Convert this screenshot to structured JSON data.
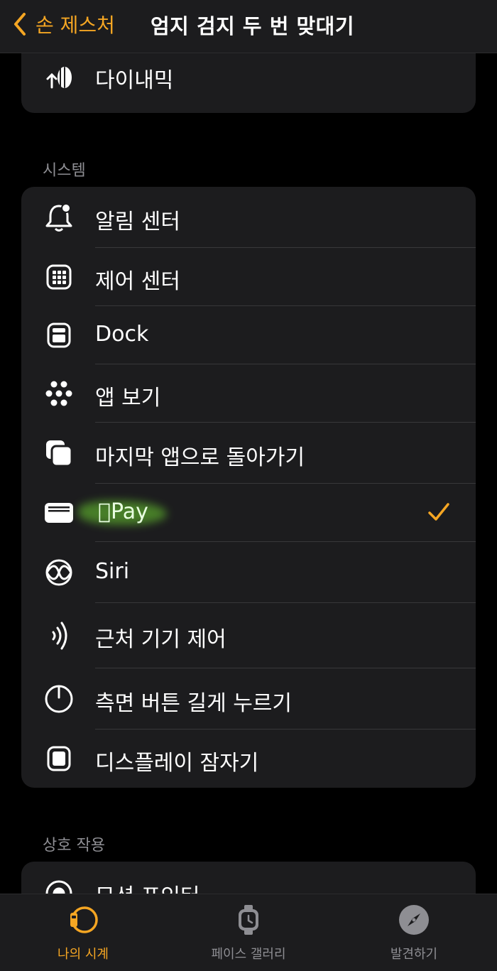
{
  "header": {
    "back_label": "손 제스처",
    "title": "엄지 검지 두 번 맞대기"
  },
  "top_item": {
    "label": "다이내믹",
    "icon": "dynamic-icon"
  },
  "system_section": {
    "header": "시스템",
    "items": [
      {
        "label": "알림 센터",
        "icon": "bell-icon"
      },
      {
        "label": "제어 센터",
        "icon": "control-center-icon"
      },
      {
        "label": "Dock",
        "icon": "dock-icon"
      },
      {
        "label": "앱 보기",
        "icon": "app-grid-icon"
      },
      {
        "label": "마지막 앱으로 돌아가기",
        "icon": "last-app-icon"
      },
      {
        "label": "Pay",
        "icon": "wallet-icon",
        "selected": true
      },
      {
        "label": "Siri",
        "icon": "siri-icon"
      },
      {
        "label": "근처 기기 제어",
        "icon": "nearby-icon"
      },
      {
        "label": "측면 버튼 길게 누르기",
        "icon": "power-icon"
      },
      {
        "label": "디스플레이 잠자기",
        "icon": "display-icon"
      }
    ]
  },
  "interaction_section": {
    "header": "상호 작용",
    "items": [
      {
        "label": "모션 포인터",
        "icon": "motion-pointer-icon"
      }
    ]
  },
  "tabbar": {
    "items": [
      {
        "label": "나의 시계",
        "icon": "watch-icon",
        "active": true
      },
      {
        "label": "페이스 갤러리",
        "icon": "watch-face-icon"
      },
      {
        "label": "발견하기",
        "icon": "compass-icon"
      }
    ]
  },
  "colors": {
    "accent": "#f5a623",
    "background": "#000000",
    "card": "#1c1c1e",
    "secondary_text": "#8e8e93"
  }
}
